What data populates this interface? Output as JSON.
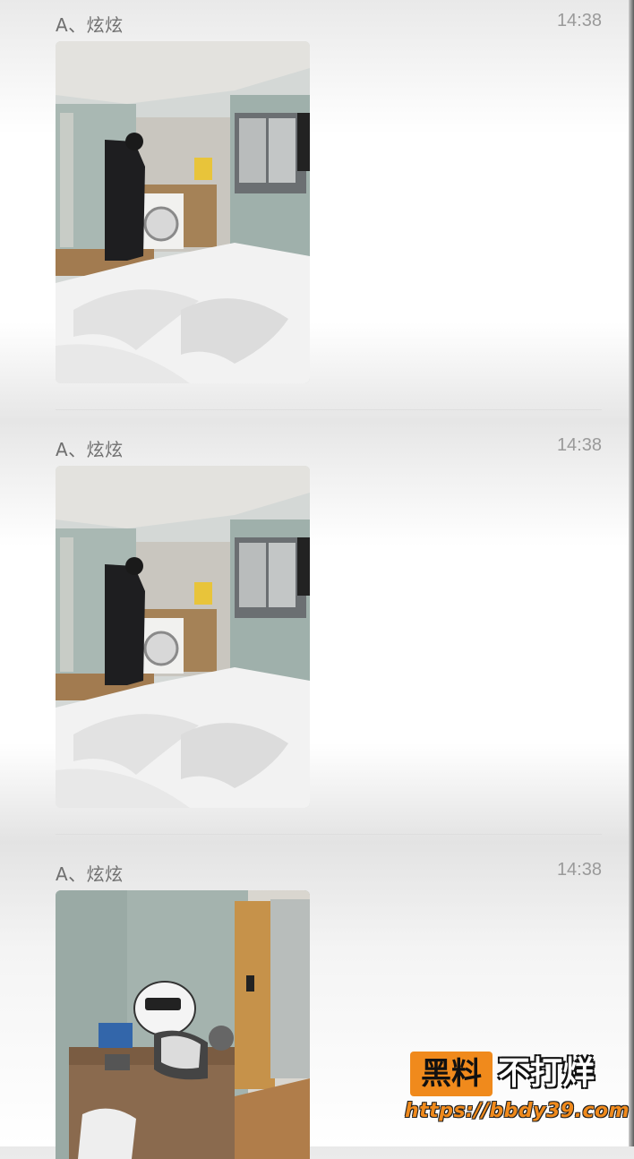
{
  "messages": [
    {
      "sender": "A、炫炫",
      "time": "14:38",
      "image": "bedroom-photo"
    },
    {
      "sender": "A、炫炫",
      "time": "14:38",
      "image": "bedroom-photo"
    },
    {
      "sender": "A、炫炫",
      "time": "14:38",
      "image": "desk-helmet-photo"
    }
  ],
  "watermark": {
    "logo": "黑料",
    "tagline": "不打烊",
    "url": "https://bbdy39.com"
  },
  "colors": {
    "watermark_orange": "#f08a1c",
    "text_gray": "#6f6f6f"
  }
}
